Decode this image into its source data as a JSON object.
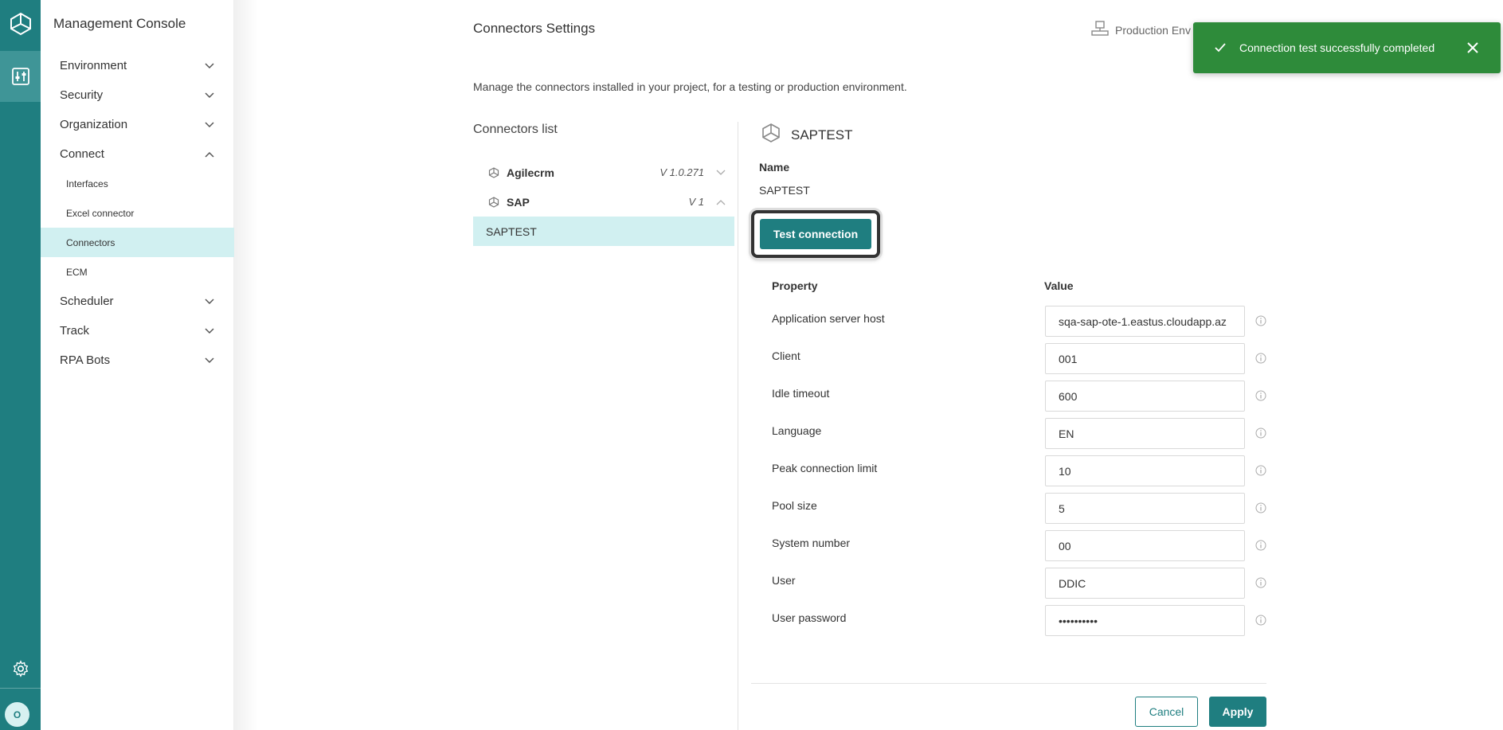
{
  "app": {
    "title": "Management Console"
  },
  "user": {
    "initial": "O"
  },
  "sidebar": {
    "items": [
      {
        "label": "Environment",
        "expanded": false
      },
      {
        "label": "Security",
        "expanded": false
      },
      {
        "label": "Organization",
        "expanded": false
      },
      {
        "label": "Connect",
        "expanded": true
      },
      {
        "label": "Interfaces"
      },
      {
        "label": "Excel connector"
      },
      {
        "label": "Connectors",
        "active": true
      },
      {
        "label": "ECM"
      },
      {
        "label": "Scheduler",
        "expanded": false
      },
      {
        "label": "Track",
        "expanded": false
      },
      {
        "label": "RPA Bots",
        "expanded": false
      }
    ]
  },
  "page": {
    "title": "Connectors Settings",
    "environment": "Production Env",
    "description": "Manage the connectors installed in your project, for a testing or production environment."
  },
  "connectors": {
    "title": "Connectors list",
    "items": [
      {
        "name": "Agilecrm",
        "version": "V 1.0.271"
      },
      {
        "name": "SAP",
        "version": "V 1"
      }
    ],
    "selected_child": "SAPTEST"
  },
  "detail": {
    "header": "SAPTEST",
    "name_label": "Name",
    "name_value": "SAPTEST",
    "test_button": "Test connection",
    "property_header": "Property",
    "value_header": "Value",
    "properties": [
      {
        "label": "Application server host",
        "value": "sqa-sap-ote-1.eastus.cloudapp.az"
      },
      {
        "label": "Client",
        "value": "001"
      },
      {
        "label": "Idle timeout",
        "value": "600"
      },
      {
        "label": "Language",
        "value": "EN"
      },
      {
        "label": "Peak connection limit",
        "value": "10"
      },
      {
        "label": "Pool size",
        "value": "5"
      },
      {
        "label": "System number",
        "value": "00"
      },
      {
        "label": "User",
        "value": "DDIC"
      },
      {
        "label": "User password",
        "value": "••••••••••"
      }
    ],
    "cancel": "Cancel",
    "apply": "Apply"
  },
  "toast": {
    "message": "Connection test successfully completed"
  },
  "colors": {
    "primary": "#1f7e80",
    "selected": "#d1f0f1",
    "success": "#2e8b3a"
  }
}
